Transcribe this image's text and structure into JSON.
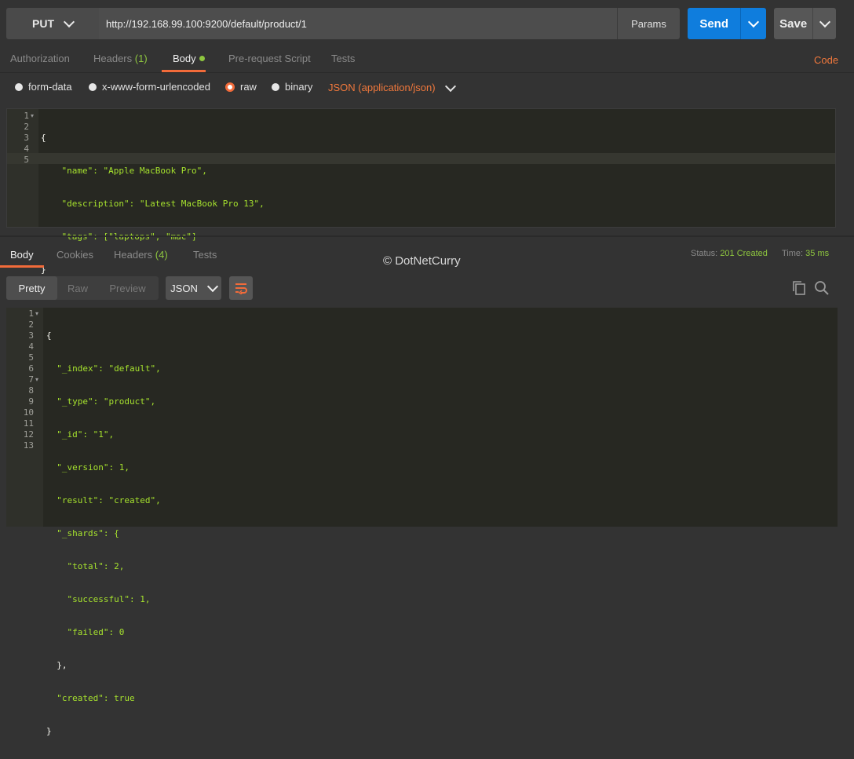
{
  "request": {
    "method": "PUT",
    "url": "http://192.168.99.100:9200/default/product/1",
    "params_label": "Params",
    "send_label": "Send",
    "save_label": "Save"
  },
  "request_tabs": {
    "authorization": "Authorization",
    "headers": "Headers",
    "headers_count": "(1)",
    "body": "Body",
    "prerequest": "Pre-request Script",
    "tests": "Tests",
    "code": "Code"
  },
  "body_modes": {
    "form_data": "form-data",
    "urlencoded": "x-www-form-urlencoded",
    "raw": "raw",
    "binary": "binary",
    "content_type": "JSON (application/json)"
  },
  "request_body": {
    "line_numbers": [
      "1",
      "2",
      "3",
      "4",
      "5"
    ],
    "lines": [
      "{",
      "    \"name\": \"Apple MacBook Pro\",",
      "    \"description\": \"Latest MacBook Pro 13\",",
      "    \"tags\": [\"laptops\", \"mac\"]",
      "}"
    ]
  },
  "response_tabs": {
    "body": "Body",
    "cookies": "Cookies",
    "headers": "Headers",
    "headers_count": "(4)",
    "tests": "Tests"
  },
  "response_status": {
    "status_label": "Status:",
    "status_value": "201 Created",
    "time_label": "Time:",
    "time_value": "35 ms"
  },
  "watermark": "© DotNetCurry",
  "response_view": {
    "pretty": "Pretty",
    "raw": "Raw",
    "preview": "Preview",
    "format": "JSON"
  },
  "response_body": {
    "line_numbers": [
      "1",
      "2",
      "3",
      "4",
      "5",
      "6",
      "7",
      "8",
      "9",
      "10",
      "11",
      "12",
      "13"
    ],
    "lines": [
      "{",
      "  \"_index\": \"default\",",
      "  \"_type\": \"product\",",
      "  \"_id\": \"1\",",
      "  \"_version\": 1,",
      "  \"result\": \"created\",",
      "  \"_shards\": {",
      "    \"total\": 2,",
      "    \"successful\": 1,",
      "    \"failed\": 0",
      "  },",
      "  \"created\": true",
      "}"
    ]
  },
  "colors": {
    "accent": "#f26b3a",
    "send": "#0f7ddd",
    "success": "#8ec63f"
  }
}
